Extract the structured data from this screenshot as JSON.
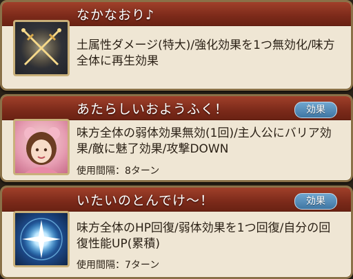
{
  "skills": [
    {
      "title": "なかなおり♪",
      "badge": "",
      "desc": "土属性ダメージ(特大)/強化効果を1つ無効化/味方全体に再生効果",
      "cooldown": ""
    },
    {
      "title": "あたらしいおようふく！",
      "badge": "効果",
      "desc": "味方全体の弱体効果無効(1回)/主人公にバリア効果/敵に魅了効果/攻撃DOWN",
      "cooldown": "使用間隔：8ターン"
    },
    {
      "title": "いたいのとんでけ〜！",
      "badge": "効果",
      "desc": "味方全体のHP回復/弱体効果を1つ回復/自分の回復性能UP(累積)",
      "cooldown": "使用間隔：7ターン"
    }
  ]
}
